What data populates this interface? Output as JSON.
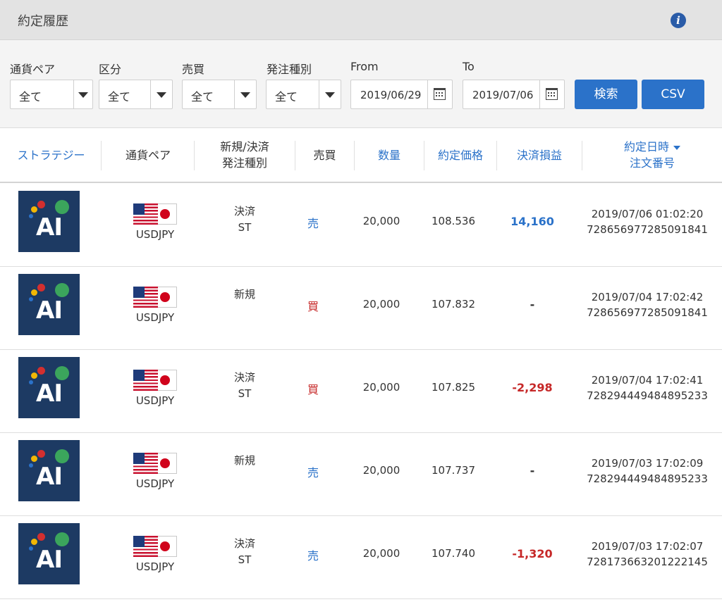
{
  "header": {
    "title": "約定履歴",
    "info_icon": "info-icon"
  },
  "filters": {
    "pair": {
      "label": "通貨ペア",
      "value": "全て"
    },
    "category": {
      "label": "区分",
      "value": "全て"
    },
    "side": {
      "label": "売買",
      "value": "全て"
    },
    "order_type": {
      "label": "発注種別",
      "value": "全て"
    },
    "from": {
      "label": "From",
      "value": "2019/06/29"
    },
    "to": {
      "label": "To",
      "value": "2019/07/06"
    },
    "search_label": "検索",
    "csv_label": "CSV"
  },
  "table": {
    "headers": {
      "strategy": "ストラテジー",
      "pair": "通貨ペア",
      "kind_line1": "新規/決済",
      "kind_line2": "発注種別",
      "side": "売買",
      "qty": "数量",
      "price": "約定価格",
      "pl": "決済損益",
      "date_line1": "約定日時",
      "date_line2": "注文番号"
    },
    "rows": [
      {
        "logo": "AI",
        "pair": "USDJPY",
        "kind1": "決済",
        "kind2": "ST",
        "side": "売",
        "qty": "20,000",
        "price": "108.536",
        "pl": "14,160",
        "datetime": "2019/07/06 01:02:20",
        "order_no": "728656977285091841"
      },
      {
        "logo": "AI",
        "pair": "USDJPY",
        "kind1": "新規",
        "kind2": "",
        "side": "買",
        "qty": "20,000",
        "price": "107.832",
        "pl": "-",
        "datetime": "2019/07/04 17:02:42",
        "order_no": "728656977285091841"
      },
      {
        "logo": "AI",
        "pair": "USDJPY",
        "kind1": "決済",
        "kind2": "ST",
        "side": "買",
        "qty": "20,000",
        "price": "107.825",
        "pl": "-2,298",
        "datetime": "2019/07/04 17:02:41",
        "order_no": "728294449484895233"
      },
      {
        "logo": "AI",
        "pair": "USDJPY",
        "kind1": "新規",
        "kind2": "",
        "side": "売",
        "qty": "20,000",
        "price": "107.737",
        "pl": "-",
        "datetime": "2019/07/03 17:02:09",
        "order_no": "728294449484895233"
      },
      {
        "logo": "AI",
        "pair": "USDJPY",
        "kind1": "決済",
        "kind2": "ST",
        "side": "売",
        "qty": "20,000",
        "price": "107.740",
        "pl": "-1,320",
        "datetime": "2019/07/03 17:02:07",
        "order_no": "728173663201222145"
      }
    ]
  },
  "colors": {
    "accent_blue": "#2b72c9",
    "loss_red": "#c62828",
    "logo_navy": "#1d3a63",
    "header_gray": "#e3e3e3",
    "filter_bg": "#f4f4f4"
  }
}
